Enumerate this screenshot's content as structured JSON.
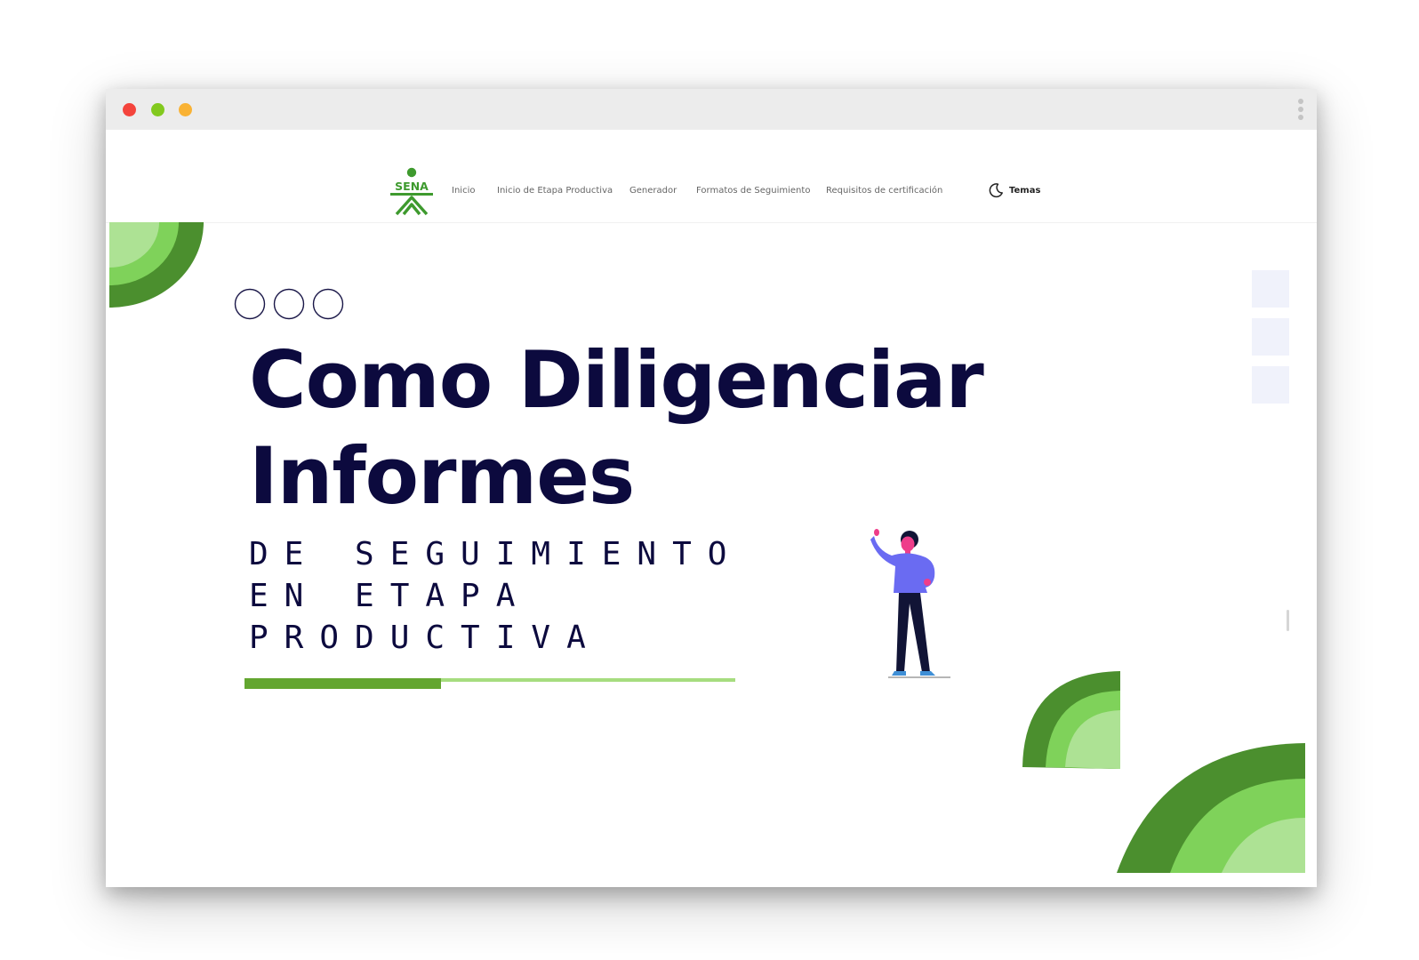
{
  "window": {
    "controls": [
      "close",
      "minimize",
      "zoom"
    ],
    "menu_icon": "kebab-menu-icon"
  },
  "nav": {
    "logo_text": "SENA",
    "items": [
      {
        "label": "Inicio"
      },
      {
        "label": "Inicio de Etapa Productiva"
      },
      {
        "label": "Generador"
      },
      {
        "label": "Formatos de Seguimiento"
      },
      {
        "label": "Requisitos de certificación"
      }
    ],
    "theme": {
      "label": "Temas",
      "icon": "moon-icon"
    }
  },
  "hero": {
    "title_line1": "Como Diligenciar",
    "title_line2": "Informes",
    "subtitle_line1": "DE SEGUIMIENTO",
    "subtitle_line2": "EN ETAPA",
    "subtitle_line3": "PRODUCTIVA",
    "progress": 0.4
  },
  "colors": {
    "brand_green": "#3e9a2e",
    "dark_green": "#4b8f2e",
    "mid_green": "#7fd25a",
    "light_green": "#ade294",
    "title": "#0c0a3e",
    "figure_shirt": "#6a6bf2",
    "figure_skin": "#ee3d8a"
  }
}
